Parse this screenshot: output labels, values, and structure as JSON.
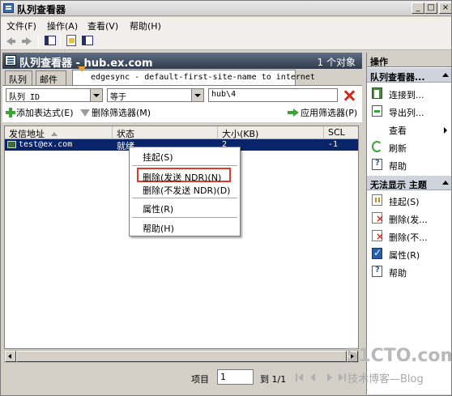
{
  "window": {
    "title": "队列查看器",
    "controls": {
      "min": "_",
      "max": "□",
      "close": "×"
    }
  },
  "menubar": {
    "file": "文件(F)",
    "action": "操作(A)",
    "view": "查看(V)",
    "help": "帮助(H)"
  },
  "header": {
    "title": "队列查看器 - hub.ex.com",
    "count": "1 个对象"
  },
  "tabs": {
    "queue": "队列",
    "mail": "邮件",
    "edgesync": "edgesync - default-first-site-name to internet"
  },
  "filter": {
    "field": "队列 ID",
    "operator": "等于",
    "value": "hub\\4"
  },
  "filter_actions": {
    "add": "添加表达式(E)",
    "remove": "删除筛选器(M)",
    "apply": "应用筛选器(P)"
  },
  "grid": {
    "columns": {
      "from": "发信地址",
      "status": "状态",
      "size": "大小(KB)",
      "scl": "SCL"
    },
    "rows": [
      {
        "from": "test@ex.com",
        "status": "就绪",
        "size": "2",
        "scl": "-1"
      }
    ]
  },
  "context_menu": {
    "suspend": "挂起(S)",
    "delete_ndr": "删除(发送 NDR)(N)",
    "delete_no_ndr": "删除(不发送 NDR)(D)",
    "properties": "属性(R)",
    "help": "帮助(H)"
  },
  "pager": {
    "label": "项目",
    "page_value": "1",
    "of": "到 1/1"
  },
  "actions_pane": {
    "title": "操作",
    "section1": "队列查看器...",
    "section1_items": {
      "connect": "连接到...",
      "export": "导出列...",
      "view": "查看",
      "refresh": "刷新",
      "help": "帮助"
    },
    "section2": "无法显示 主题",
    "section2_items": {
      "suspend": "挂起(S)",
      "delete_ndr": "删除(发...",
      "delete_no_ndr": "删除(不...",
      "properties": "属性(R)",
      "help": "帮助"
    }
  },
  "watermark": {
    "brand": "51CTO.com",
    "tagline": "技术博客—Blog"
  },
  "colors": {
    "selection": "#0a246a",
    "highlight_border": "#e23a2a",
    "header_bg": "#2f3a4c"
  }
}
